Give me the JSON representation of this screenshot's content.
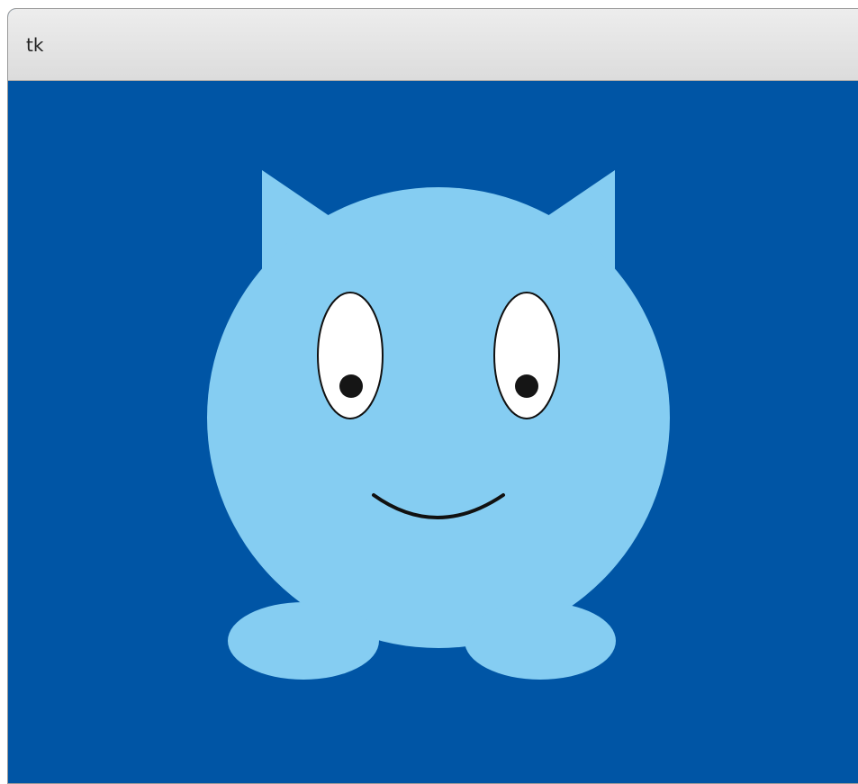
{
  "window": {
    "title": "tk"
  },
  "colors": {
    "background": "#0055a5",
    "body": "#85cdf2",
    "eye_white": "#ffffff",
    "pupil": "#151515",
    "outline": "#111111",
    "titlebar": "#e2e2e2"
  },
  "figure": {
    "name": "monster",
    "parts": [
      "ears",
      "body",
      "eyes",
      "pupils",
      "smile",
      "feet"
    ]
  }
}
